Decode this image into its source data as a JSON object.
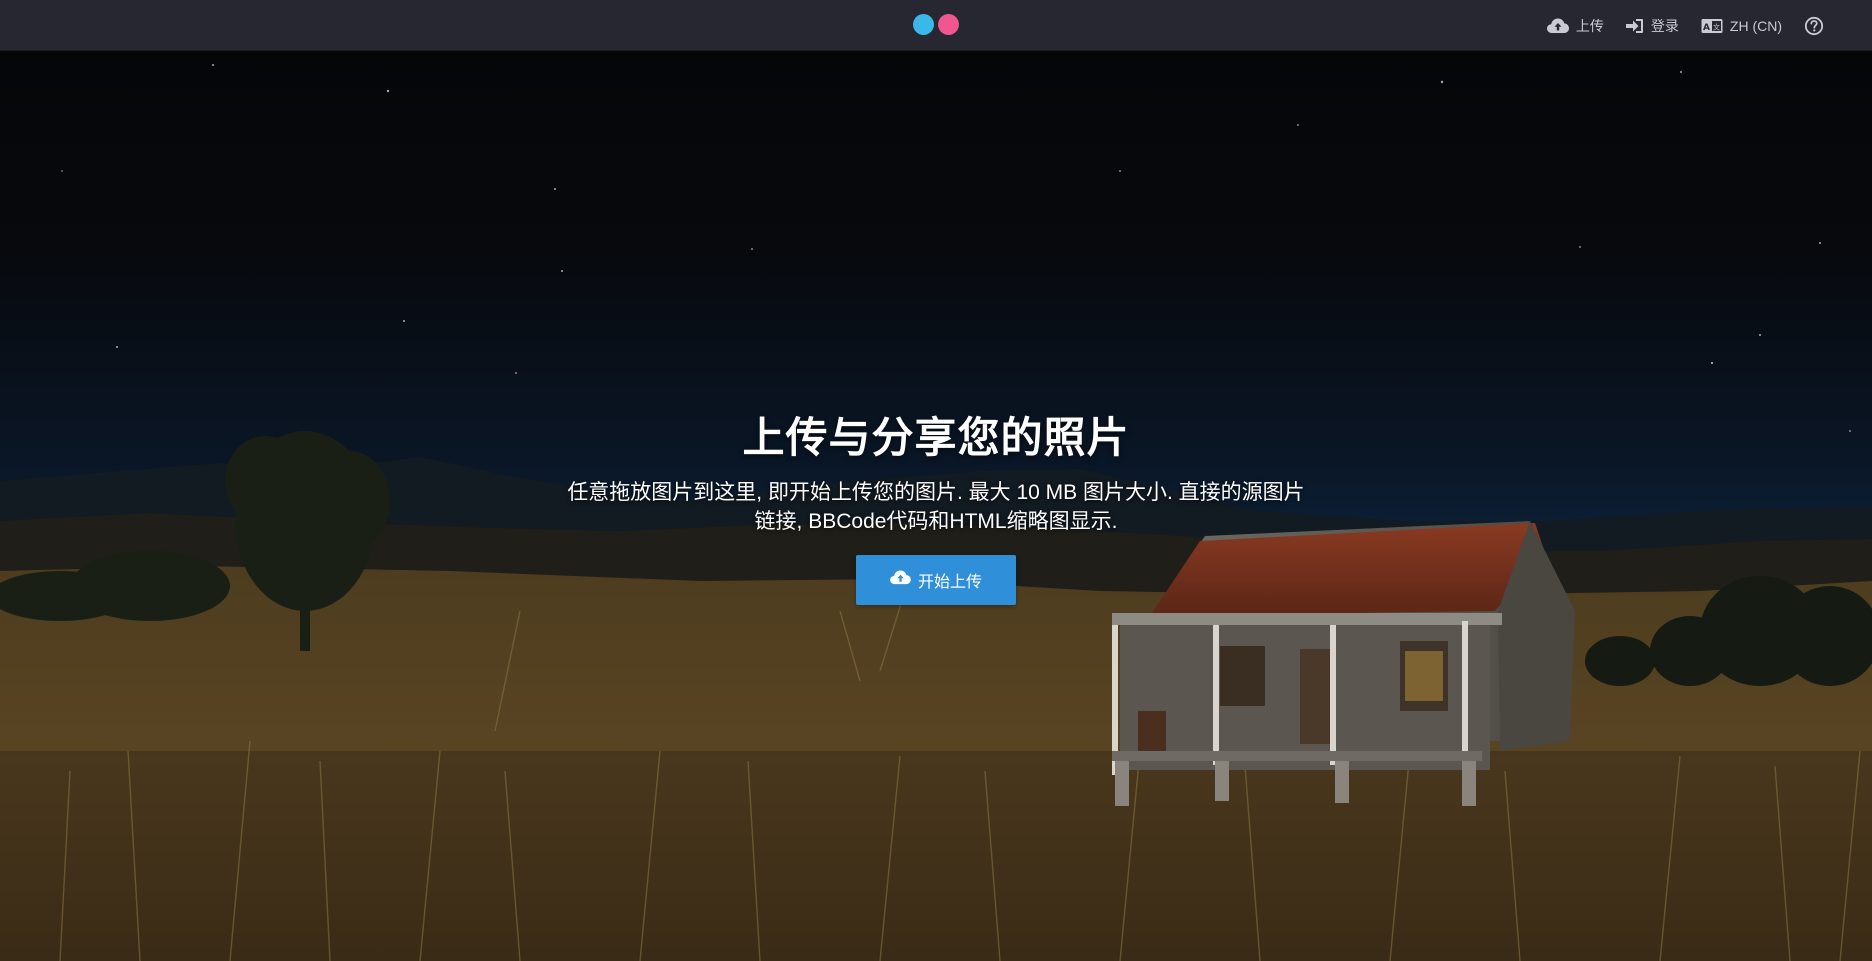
{
  "brand": {
    "dot_colors": [
      "#3ab8ea",
      "#f0568f"
    ]
  },
  "nav": {
    "upload_label": "上传",
    "login_label": "登录",
    "language_label": "ZH (CN)",
    "upload_icon": "cloud-upload-icon",
    "login_icon": "sign-in-icon",
    "language_icon": "language-icon",
    "help_icon": "help-icon"
  },
  "hero": {
    "title": "上传与分享您的照片",
    "description_line1": "任意拖放图片到这里, 即开始上传您的图片. 最大 10 MB 图片大小. 直接的源图片",
    "description_line2": "链接, BBCode代码和HTML缩略图显示.",
    "button_label": "开始上传",
    "button_icon": "cloud-upload-icon",
    "accent_color": "#2f8fd8"
  }
}
